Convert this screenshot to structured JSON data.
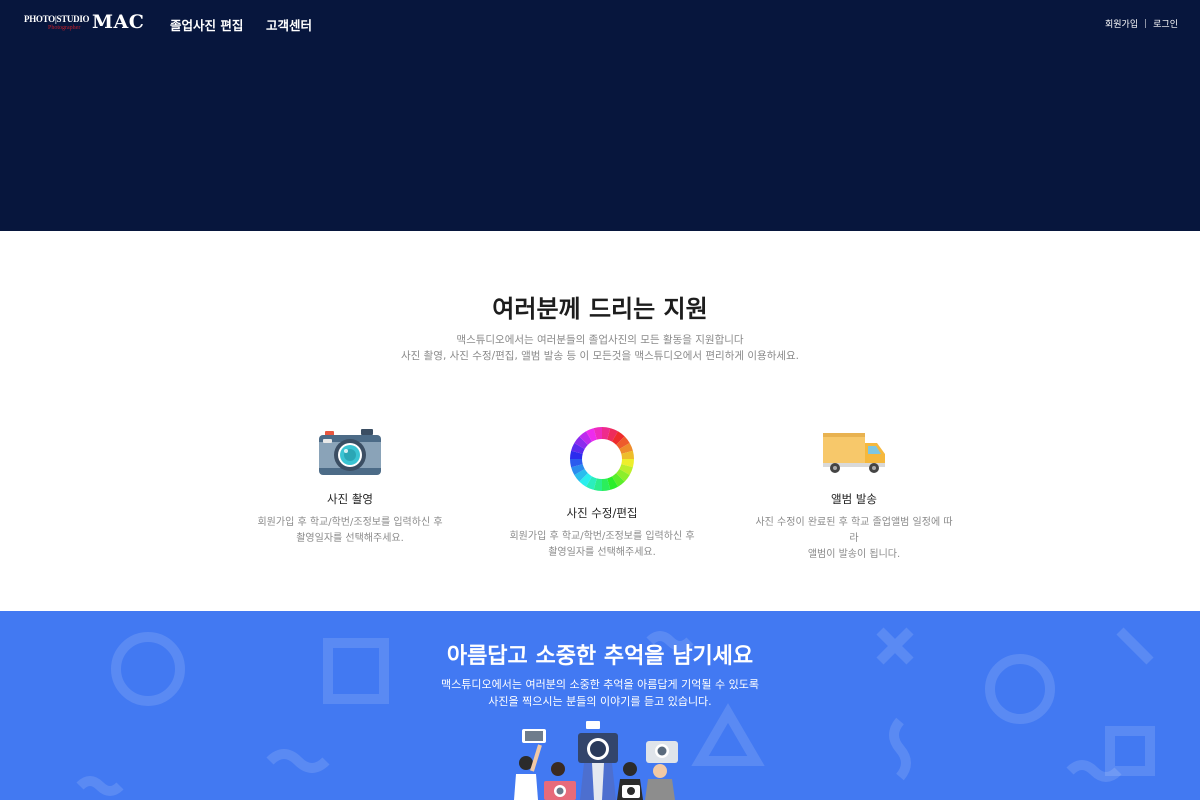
{
  "header": {
    "logo": {
      "photo_text": "PHOTO|STUDIO",
      "sub_text": "Photographer",
      "brand_text": "MAC"
    },
    "nav": [
      "졸업사진 편집",
      "고객센터"
    ],
    "util": {
      "signup": "회원가입",
      "separator": "|",
      "login": "로그인"
    }
  },
  "support": {
    "title": "여러분께 드리는 지원",
    "desc_lines": [
      "맥스튜디오에서는 여러분들의 졸업사진의 모든 활동을 지원합니다",
      "사진 촬영, 사진 수정/편집, 앨범 발송 등 이 모든것을 맥스튜디오에서 편리하게 이용하세요."
    ],
    "features": [
      {
        "icon": "camera-icon",
        "title": "사진 촬영",
        "desc_lines": [
          "회원가입 후 학교/학번/조정보를 입력하신 후",
          "촬영일자를 선택해주세요."
        ]
      },
      {
        "icon": "color-wheel-icon",
        "title": "사진 수정/편집",
        "desc_lines": [
          "회원가입 후 학교/학번/조정보를 입력하신 후",
          "촬영일자를 선택해주세요."
        ]
      },
      {
        "icon": "truck-icon",
        "title": "앨범 발송",
        "desc_lines": [
          "사진 수정이 완료된 후 학교 졸업앨범 일정에 따",
          "라",
          "앨범이 발송이 됩니다."
        ]
      }
    ]
  },
  "memory": {
    "title": "아름답고 소중한 추억을 남기세요",
    "desc_lines": [
      "맥스튜디오에서는 여러분의 소중한 추억을 아름답게 기억될 수 있도록",
      "사진을 찍으시는 분들의 이야기를 듣고 있습니다."
    ]
  },
  "colors": {
    "hero_bg": "#07163d",
    "memory_bg": "#4279f2",
    "logo_accent": "#c41f2a"
  }
}
